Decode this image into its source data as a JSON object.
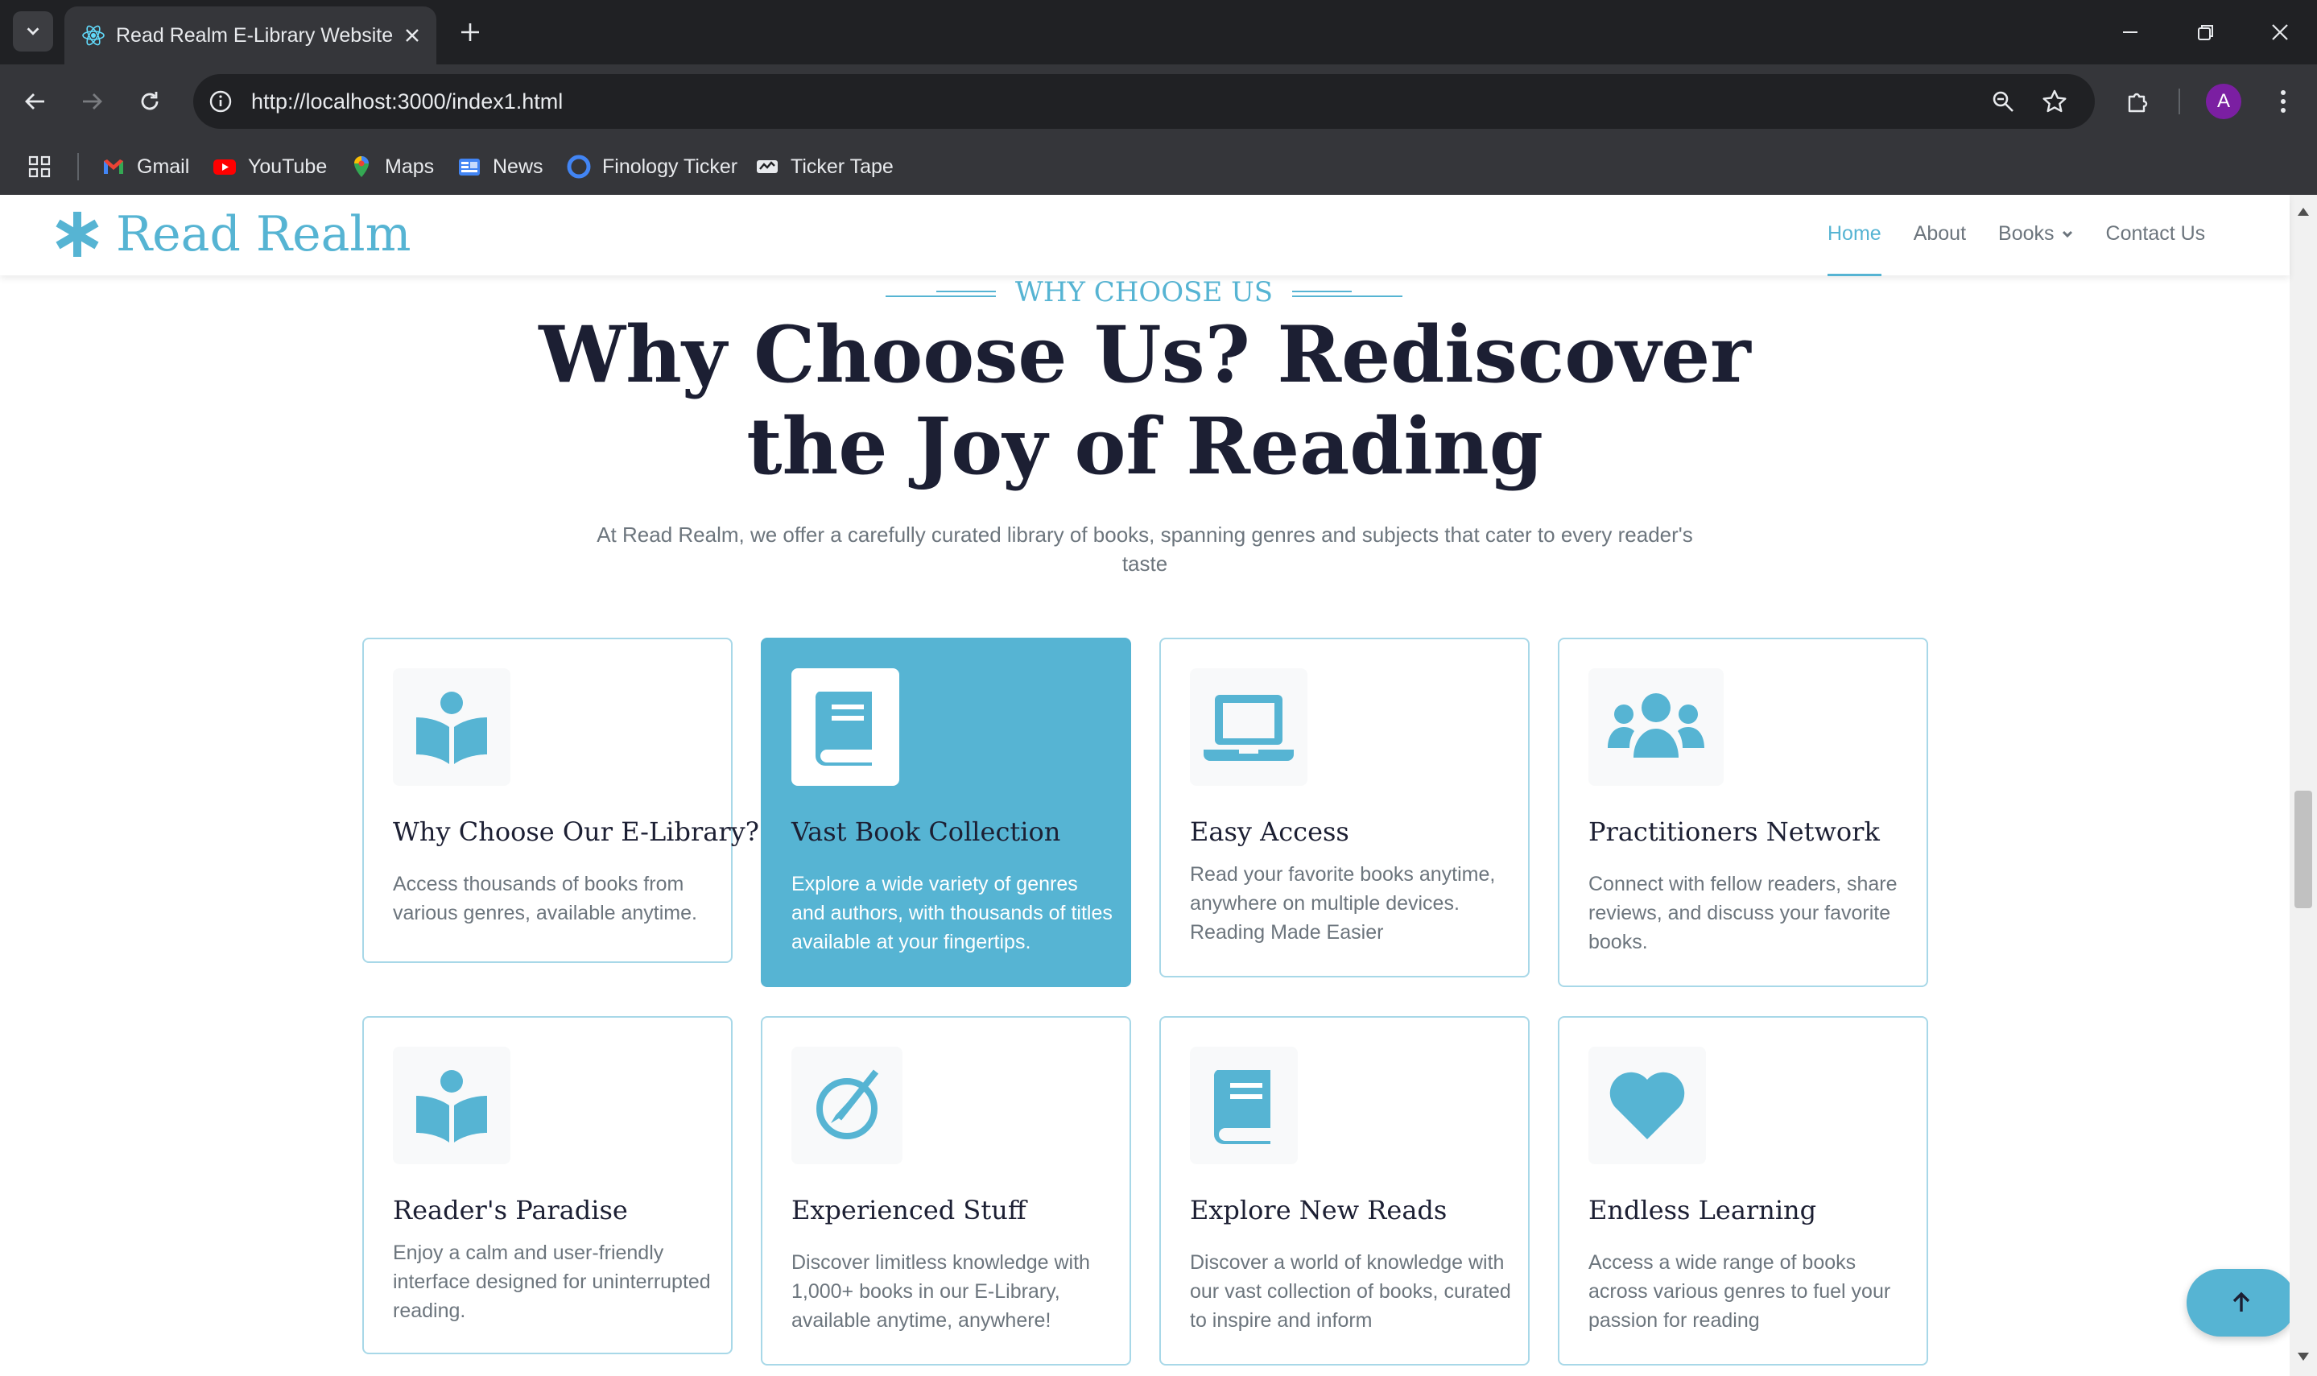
{
  "browser": {
    "tab": {
      "title": "Read Realm E-Library Website",
      "favicon": "react-icon"
    },
    "url": "http://localhost:3000/index1.html",
    "profile_initial": "A",
    "bookmarks": [
      {
        "label": "Gmail",
        "icon": "gmail-icon",
        "color": "#ea4335"
      },
      {
        "label": "YouTube",
        "icon": "youtube-icon",
        "color": "#ff0000"
      },
      {
        "label": "Maps",
        "icon": "maps-icon",
        "color": "#34a853"
      },
      {
        "label": "News",
        "icon": "news-icon",
        "color": "#4285f4"
      },
      {
        "label": "Finology Ticker",
        "icon": "finology-icon",
        "color": "#4285f4"
      },
      {
        "label": "Ticker Tape",
        "icon": "tickertape-icon",
        "color": "#e8eaed"
      }
    ]
  },
  "site": {
    "brand": "Read Realm",
    "brand_icon": "asterisk-icon",
    "accent_color": "#56b4d3",
    "nav": [
      {
        "label": "Home",
        "active": true
      },
      {
        "label": "About",
        "active": false
      },
      {
        "label": "Books",
        "active": false,
        "dropdown": true
      },
      {
        "label": "Contact Us",
        "active": false
      }
    ]
  },
  "section": {
    "eyebrow": "WHY CHOOSE US",
    "headline_line1": "Why Choose Us? Rediscover",
    "headline_line2": "the Joy of Reading",
    "subtitle": "At Read Realm, we offer a carefully curated library of books, spanning genres and subjects that cater to every reader's taste"
  },
  "cards": [
    {
      "title": "Why Choose Our E-Library?",
      "text": "Access thousands of books from various genres, available anytime.",
      "icon": "book-reader-icon"
    },
    {
      "title": "Vast Book Collection",
      "text": "Explore a wide variety of genres and authors, with thousands of titles available at your fingertips.",
      "icon": "book-icon",
      "featured": true
    },
    {
      "title": "Easy Access",
      "text": "Read your favorite books anytime, anywhere on multiple devices. Reading Made Easier",
      "icon": "laptop-icon"
    },
    {
      "title": "Practitioners Network",
      "text": "Connect with fellow readers, share reviews, and discuss your favorite books.",
      "icon": "users-icon"
    },
    {
      "title": "Reader's Paradise",
      "text": "Enjoy a calm and user-friendly interface designed for uninterrupted reading.",
      "icon": "book-reader-icon"
    },
    {
      "title": "Experienced Stuff",
      "text": "Discover limitless knowledge with 1,000+ books in our E-Library, available anytime, anywhere!",
      "icon": "compass-icon"
    },
    {
      "title": "Explore New Reads",
      "text": "Discover a world of knowledge with our vast collection of books, curated to inspire and inform",
      "icon": "book-icon"
    },
    {
      "title": "Endless Learning",
      "text": "Access a wide range of books across various genres to fuel your passion for reading",
      "icon": "heart-icon"
    }
  ]
}
